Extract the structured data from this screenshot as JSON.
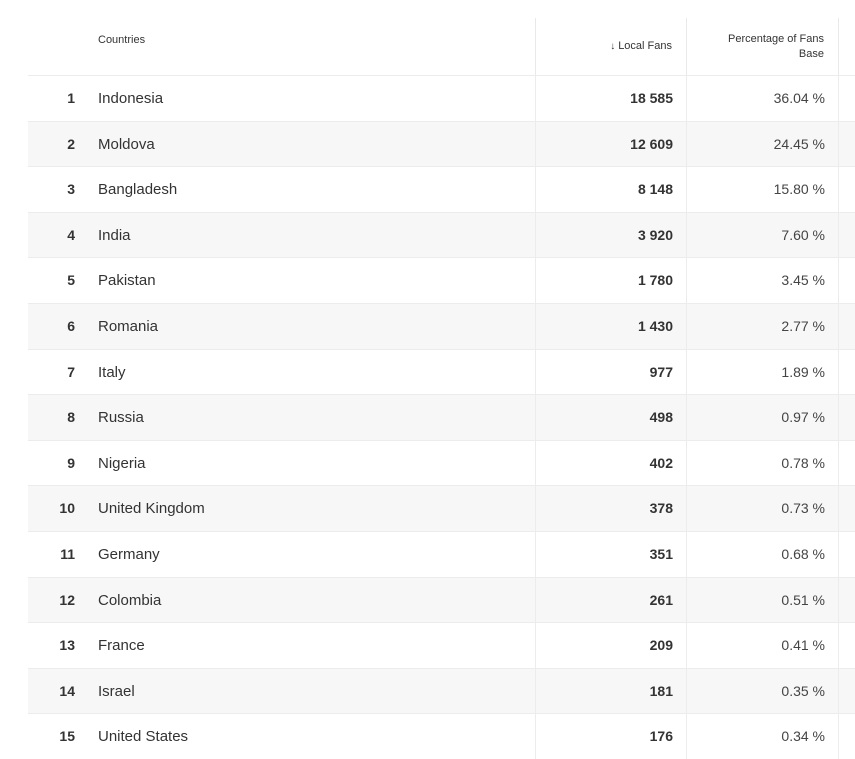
{
  "header": {
    "countries": "Countries",
    "local_fans": "Local Fans",
    "sort_icon": "↓",
    "percentage_line1": "Percentage of Fans",
    "percentage_line2": "Base"
  },
  "rows": [
    {
      "rank": "1",
      "country": "Indonesia",
      "fans": "18 585",
      "pct": "36.04 %"
    },
    {
      "rank": "2",
      "country": "Moldova",
      "fans": "12 609",
      "pct": "24.45 %"
    },
    {
      "rank": "3",
      "country": "Bangladesh",
      "fans": "8 148",
      "pct": "15.80 %"
    },
    {
      "rank": "4",
      "country": "India",
      "fans": "3 920",
      "pct": "7.60 %"
    },
    {
      "rank": "5",
      "country": "Pakistan",
      "fans": "1 780",
      "pct": "3.45 %"
    },
    {
      "rank": "6",
      "country": "Romania",
      "fans": "1 430",
      "pct": "2.77 %"
    },
    {
      "rank": "7",
      "country": "Italy",
      "fans": "977",
      "pct": "1.89 %"
    },
    {
      "rank": "8",
      "country": "Russia",
      "fans": "498",
      "pct": "0.97 %"
    },
    {
      "rank": "9",
      "country": "Nigeria",
      "fans": "402",
      "pct": "0.78 %"
    },
    {
      "rank": "10",
      "country": "United Kingdom",
      "fans": "378",
      "pct": "0.73 %"
    },
    {
      "rank": "11",
      "country": "Germany",
      "fans": "351",
      "pct": "0.68 %"
    },
    {
      "rank": "12",
      "country": "Colombia",
      "fans": "261",
      "pct": "0.51 %"
    },
    {
      "rank": "13",
      "country": "France",
      "fans": "209",
      "pct": "0.41 %"
    },
    {
      "rank": "14",
      "country": "Israel",
      "fans": "181",
      "pct": "0.35 %"
    },
    {
      "rank": "15",
      "country": "United States",
      "fans": "176",
      "pct": "0.34 %"
    }
  ]
}
